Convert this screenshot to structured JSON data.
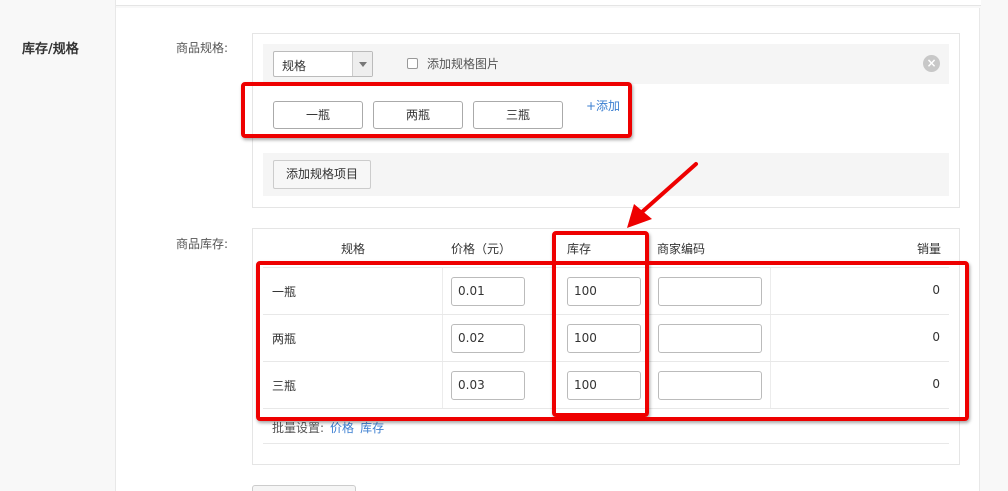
{
  "section": {
    "title": "库存/规格"
  },
  "spec": {
    "label": "商品规格:",
    "select_value": "规格",
    "image_checkbox_label": "添加规格图片",
    "close_icon": "close-icon",
    "values": [
      "一瓶",
      "两瓶",
      "三瓶"
    ],
    "add_link": "+添加",
    "add_item_button": "添加规格项目"
  },
  "stock": {
    "label": "商品库存:",
    "headers": {
      "spec": "规格",
      "price": "价格（元）",
      "stock": "库存",
      "code": "商家编码",
      "sales": "销量"
    },
    "rows": [
      {
        "name": "一瓶",
        "price": "0.01",
        "stock": "100",
        "code": "",
        "sales": "0"
      },
      {
        "name": "两瓶",
        "price": "0.02",
        "stock": "100",
        "code": "",
        "sales": "0"
      },
      {
        "name": "三瓶",
        "price": "0.03",
        "stock": "100",
        "code": "",
        "sales": "0"
      }
    ],
    "batch_label": "批量设置:",
    "batch_price": "价格",
    "batch_stock": "库存"
  },
  "colors": {
    "annotation": "#e00000",
    "link": "#3c7fd1"
  }
}
